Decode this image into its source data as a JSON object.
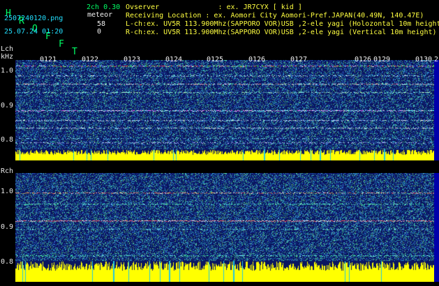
{
  "header": {
    "app_title_letters": [
      "H",
      "R",
      "O",
      "F",
      "F",
      "T"
    ],
    "channel_info": "2ch 0.30",
    "filename": "2507240120.png",
    "meteor_label": "meteor",
    "count_l": "58",
    "count_r": "0",
    "datetime": "25.07.24 01:20",
    "observer_line": "Ovserver              : ex. JR7CYX [ kid ]",
    "location_line": "Receiving Location : ex. Aomori City Aomori-Pref.JAPAN(40.49N, 140.47E)",
    "lch_line": "L-ch:ex. UV5R 113.900Mhz(SAPPORO VOR)USB ,2-ele yagi (Holozontal 10m height)",
    "rch_line": "R-ch:ex. UV5R 113.900Mhz(SAPPORO VOR)USB ,2-ele yagi (Vertical 10m height)"
  },
  "time_ticks": [
    "0121",
    "0122",
    "0123",
    "0124",
    "0125",
    "0126",
    "0127",
    "0126",
    "0129",
    "0130",
    "2"
  ],
  "left_panel": {
    "label": "Lch",
    "unit": "kHz",
    "y_labels": [
      "1.0",
      "0.9",
      "0.8"
    ]
  },
  "right_panel": {
    "label": "Rch",
    "y_labels": [
      "1.0",
      "0.9",
      "0.8"
    ]
  },
  "colors": {
    "background": "#000000",
    "waterfall_base": "#0a1660",
    "signal_yellow": "#ffff00",
    "header_green": "#00ff66",
    "header_cyan": "#22e0ff"
  }
}
